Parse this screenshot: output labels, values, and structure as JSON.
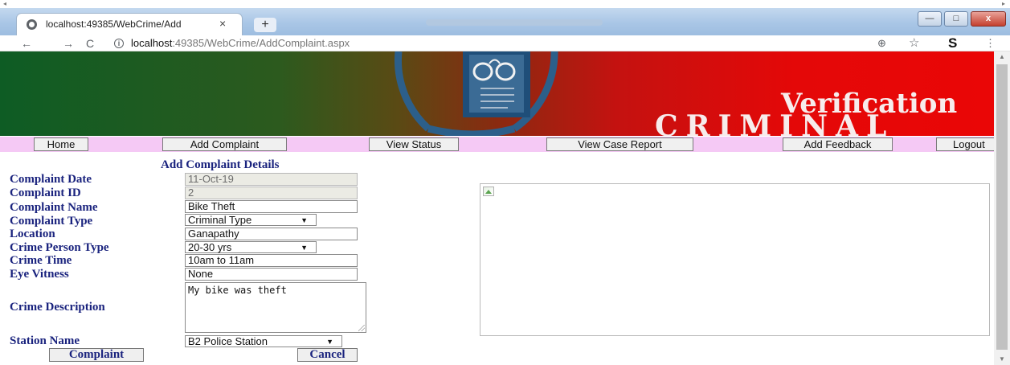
{
  "browser": {
    "tab_title": "localhost:49385/WebCrime/Add",
    "tab_close": "×",
    "new_tab": "+",
    "back": "←",
    "forward": "→",
    "reload": "C",
    "info": "i",
    "url_host": "localhost",
    "url_path": ":49385/WebCrime/AddComplaint.aspx",
    "zoom_icon": "⊕",
    "star_icon": "☆",
    "extension_icon": "S",
    "menu_icon": "⋮",
    "win_min": "—",
    "win_max": "□",
    "win_close": "x"
  },
  "banner": {
    "title": "Verification",
    "subtitle": "CRIMINAL"
  },
  "menu": {
    "home": "Home",
    "add_complaint": "Add Complaint",
    "view_status": "View Status",
    "view_case_report": "View Case Report",
    "add_feedback": "Add Feedback",
    "logout": "Logout"
  },
  "form": {
    "heading": "Add Complaint Details",
    "labels": {
      "complaint_date": "Complaint Date",
      "complaint_id": "Complaint ID",
      "complaint_name": "Complaint Name",
      "complaint_type": "Complaint Type",
      "location": "Location",
      "crime_person_type": "Crime Person Type",
      "crime_time": "Crime Time",
      "eye_witness": "Eye Vitness",
      "crime_description": "Crime Description",
      "station_name": "Station Name"
    },
    "values": {
      "complaint_date": "11-Oct-19",
      "complaint_id": "2",
      "complaint_name": "Bike Theft",
      "complaint_type": "Criminal Type",
      "location": "Ganapathy",
      "crime_person_type": "20-30 yrs",
      "crime_time": "10am to 11am",
      "eye_witness": "None",
      "crime_description": "My bike was theft",
      "station_name": "B2 Police Station"
    },
    "buttons": {
      "submit": "Complaint",
      "cancel": "Cancel"
    }
  },
  "colors": {
    "label_color": "#1a237e",
    "menubar_bg": "#f5c9f5",
    "banner_green": "#0e5c24",
    "banner_red": "#e40808"
  }
}
